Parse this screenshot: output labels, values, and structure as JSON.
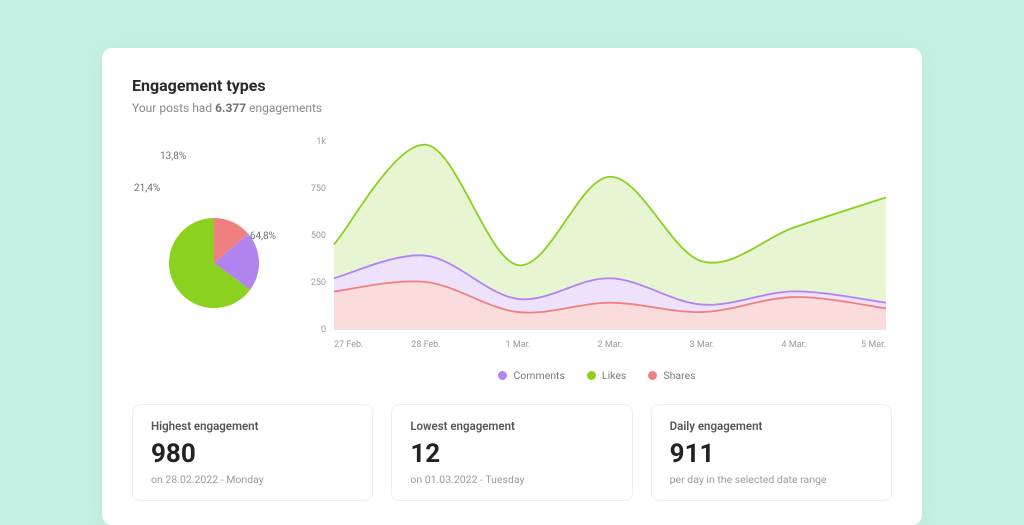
{
  "header": {
    "title": "Engagement types",
    "subtitle_prefix": "Your posts had ",
    "subtitle_value": "6.377",
    "subtitle_suffix": " engagements"
  },
  "colors": {
    "likes": "#8ad120",
    "comments": "#b184ef",
    "shares": "#f08080",
    "likes_fill": "#e7f5d3",
    "comments_fill": "#ede1fb",
    "shares_fill": "#fadcdc",
    "axis": "#cfcfcf",
    "text": "#9a9a9a"
  },
  "legend": {
    "comments": "Comments",
    "likes": "Likes",
    "shares": "Shares"
  },
  "stats": [
    {
      "title": "Highest engagement",
      "value": "980",
      "sub": "on 28.02.2022 - Monday"
    },
    {
      "title": "Lowest engagement",
      "value": "12",
      "sub": "on 01.03.2022 - Tuesday"
    },
    {
      "title": "Daily engagement",
      "value": "911",
      "sub": "per day in the selected date range"
    }
  ],
  "chart_data": [
    {
      "type": "pie",
      "title": "Engagement share",
      "slices": [
        {
          "name": "Likes",
          "value": 64.8,
          "label": "64,8%",
          "color": "#8ad120"
        },
        {
          "name": "Comments",
          "value": 21.4,
          "label": "21,4%",
          "color": "#b184ef"
        },
        {
          "name": "Shares",
          "value": 13.8,
          "label": "13,8%",
          "color": "#f08080"
        }
      ]
    },
    {
      "type": "area",
      "title": "Engagement over time",
      "categories": [
        "27 Feb.",
        "28 Feb.",
        "1 Mar.",
        "2 Mar.",
        "3 Mar.",
        "4 Mar.",
        "5 Mar."
      ],
      "y_ticks": [
        0,
        250,
        500,
        750,
        "1k"
      ],
      "ylim": [
        0,
        1000
      ],
      "xlabel": "",
      "ylabel": "",
      "series": [
        {
          "name": "Likes",
          "color": "#8ad120",
          "values": [
            450,
            980,
            340,
            810,
            360,
            540,
            700
          ]
        },
        {
          "name": "Comments",
          "color": "#b184ef",
          "values": [
            270,
            390,
            160,
            270,
            130,
            200,
            140
          ]
        },
        {
          "name": "Shares",
          "color": "#f08080",
          "values": [
            200,
            250,
            90,
            140,
            90,
            170,
            110
          ]
        }
      ]
    }
  ]
}
